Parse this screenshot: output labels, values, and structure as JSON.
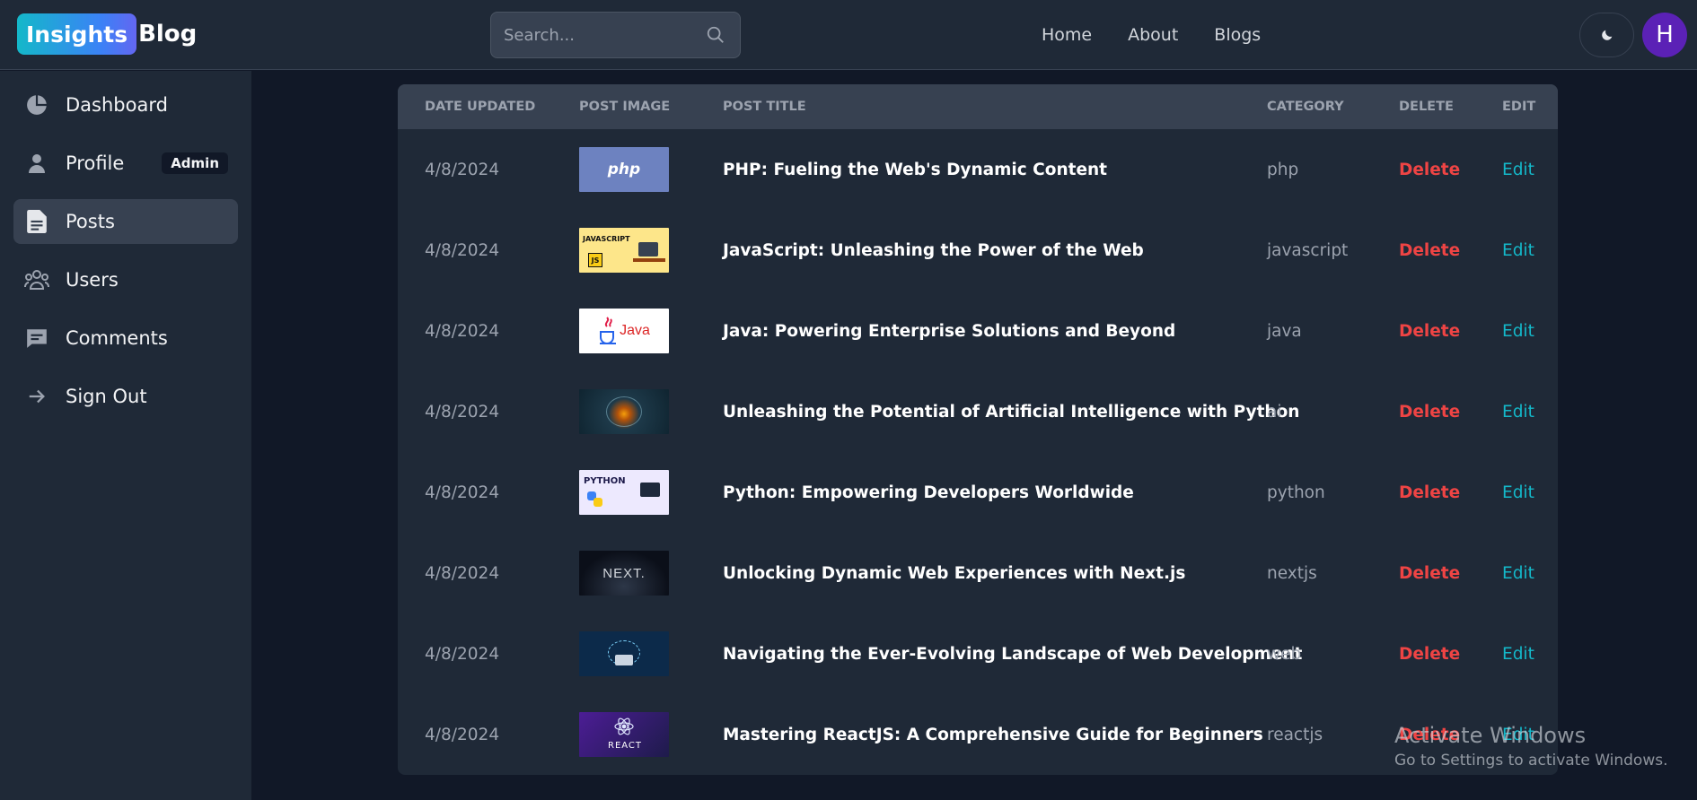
{
  "header": {
    "logo_badge": "Insights",
    "logo_text": "Blog",
    "search_placeholder": "Search...",
    "nav": [
      "Home",
      "About",
      "Blogs"
    ],
    "avatar_initial": "H"
  },
  "sidebar": {
    "items": [
      {
        "label": "Dashboard",
        "icon": "pie-chart-icon"
      },
      {
        "label": "Profile",
        "icon": "user-icon",
        "badge": "Admin"
      },
      {
        "label": "Posts",
        "icon": "document-icon",
        "active": true
      },
      {
        "label": "Users",
        "icon": "users-icon"
      },
      {
        "label": "Comments",
        "icon": "comment-icon"
      },
      {
        "label": "Sign Out",
        "icon": "arrow-right-icon"
      }
    ]
  },
  "table": {
    "headers": [
      "Date Updated",
      "Post Image",
      "Post Title",
      "Category",
      "Delete",
      "Edit"
    ],
    "delete_label": "Delete",
    "edit_label": "Edit",
    "rows": [
      {
        "date": "4/8/2024",
        "title": "PHP: Fueling the Web's Dynamic Content",
        "category": "php",
        "image": "php"
      },
      {
        "date": "4/8/2024",
        "title": "JavaScript: Unleashing the Power of the Web",
        "category": "javascript",
        "image": "javascript"
      },
      {
        "date": "4/8/2024",
        "title": "Java: Powering Enterprise Solutions and Beyond",
        "category": "java",
        "image": "java"
      },
      {
        "date": "4/8/2024",
        "title": "Unleashing the Potential of Artificial Intelligence with Python",
        "category": "ai",
        "image": "ai"
      },
      {
        "date": "4/8/2024",
        "title": "Python: Empowering Developers Worldwide",
        "category": "python",
        "image": "python"
      },
      {
        "date": "4/8/2024",
        "title": "Unlocking Dynamic Web Experiences with Next.js",
        "category": "nextjs",
        "image": "nextjs"
      },
      {
        "date": "4/8/2024",
        "title": "Navigating the Ever-Evolving Landscape of Web Development",
        "category": "web",
        "image": "web"
      },
      {
        "date": "4/8/2024",
        "title": "Mastering ReactJS: A Comprehensive Guide for Beginners",
        "category": "reactjs",
        "image": "reactjs"
      }
    ]
  },
  "thumb_text": {
    "php": "php",
    "javascript": "JAVASCRIPT",
    "javascript_badge": "JS",
    "java": "Java",
    "python": "PYTHON",
    "nextjs": "NEXT.",
    "reactjs": "REACT"
  },
  "watermark": {
    "line1": "Activate Windows",
    "line2": "Go to Settings to activate Windows."
  },
  "colors": {
    "background": "#111827",
    "panel": "#1f2937",
    "accent": "#14b8c9",
    "danger": "#ef4444"
  }
}
